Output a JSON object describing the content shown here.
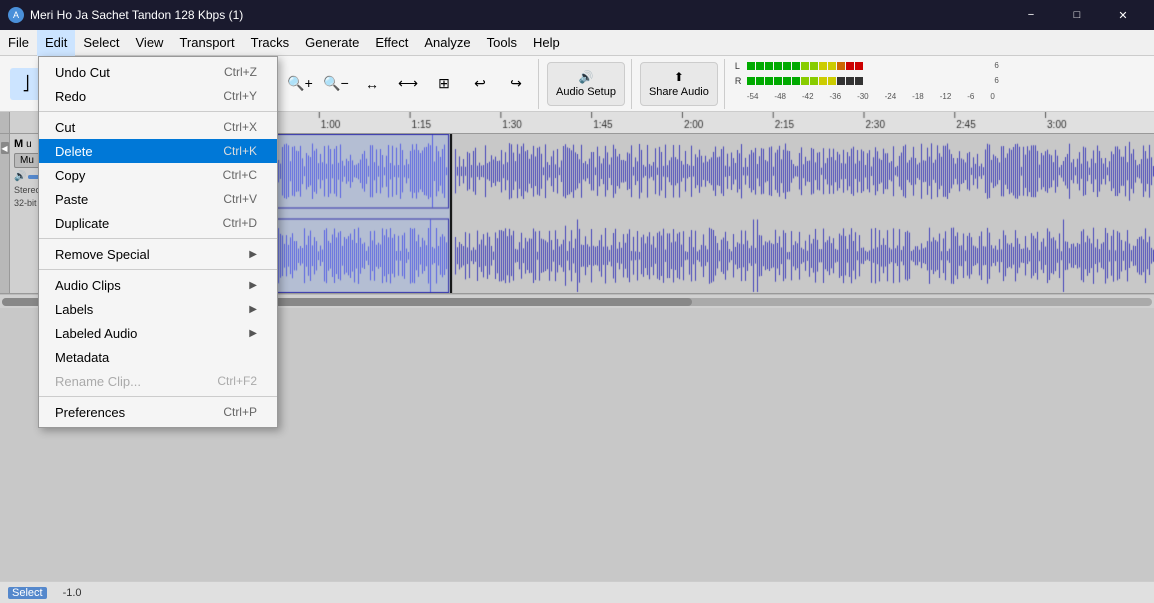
{
  "titlebar": {
    "title": "Meri Ho Ja Sachet Tandon 128 Kbps (1)",
    "icon": "A",
    "minimize": "−",
    "maximize": "□",
    "close": "✕"
  },
  "menubar": {
    "items": [
      "File",
      "Edit",
      "Select",
      "View",
      "Transport",
      "Tracks",
      "Generate",
      "Effect",
      "Analyze",
      "Tools",
      "Help"
    ]
  },
  "edit_menu": {
    "items": [
      {
        "label": "Undo Cut",
        "shortcut": "Ctrl+Z",
        "disabled": false
      },
      {
        "label": "Redo",
        "shortcut": "Ctrl+Y",
        "disabled": false
      },
      {
        "label": "",
        "separator": true
      },
      {
        "label": "Cut",
        "shortcut": "Ctrl+X",
        "disabled": false
      },
      {
        "label": "Delete",
        "shortcut": "Ctrl+K",
        "disabled": false,
        "highlighted": true
      },
      {
        "label": "Copy",
        "shortcut": "Ctrl+C",
        "disabled": false
      },
      {
        "label": "Paste",
        "shortcut": "Ctrl+V",
        "disabled": false
      },
      {
        "label": "Duplicate",
        "shortcut": "Ctrl+D",
        "disabled": false
      },
      {
        "label": "",
        "separator": true
      },
      {
        "label": "Remove Special",
        "shortcut": "",
        "disabled": false,
        "arrow": true
      },
      {
        "label": "",
        "separator": true
      },
      {
        "label": "Audio Clips",
        "shortcut": "",
        "disabled": false,
        "arrow": true
      },
      {
        "label": "Labels",
        "shortcut": "",
        "disabled": false,
        "arrow": true
      },
      {
        "label": "Labeled Audio",
        "shortcut": "",
        "disabled": false,
        "arrow": true
      },
      {
        "label": "Metadata",
        "shortcut": "",
        "disabled": false
      },
      {
        "label": "Rename Clip...",
        "shortcut": "Ctrl+F2",
        "disabled": true
      },
      {
        "label": "",
        "separator": true
      },
      {
        "label": "Preferences",
        "shortcut": "Ctrl+P",
        "disabled": false
      }
    ]
  },
  "track": {
    "name": "M",
    "full_name": "Meri Ho Ja Sachet Tandon 128 Kbps (1)",
    "type": "Stereo",
    "rate": "32-bit",
    "close_btn": "✕"
  },
  "statusbar": {
    "tool": "Select",
    "position": "-1.0"
  },
  "toolbar": {
    "record": "●",
    "pause": "⏸",
    "stop": "■",
    "play": "▶",
    "skip_start": "⏮",
    "skip_end": "⏭",
    "zoom_in": "+",
    "zoom_out": "−"
  }
}
